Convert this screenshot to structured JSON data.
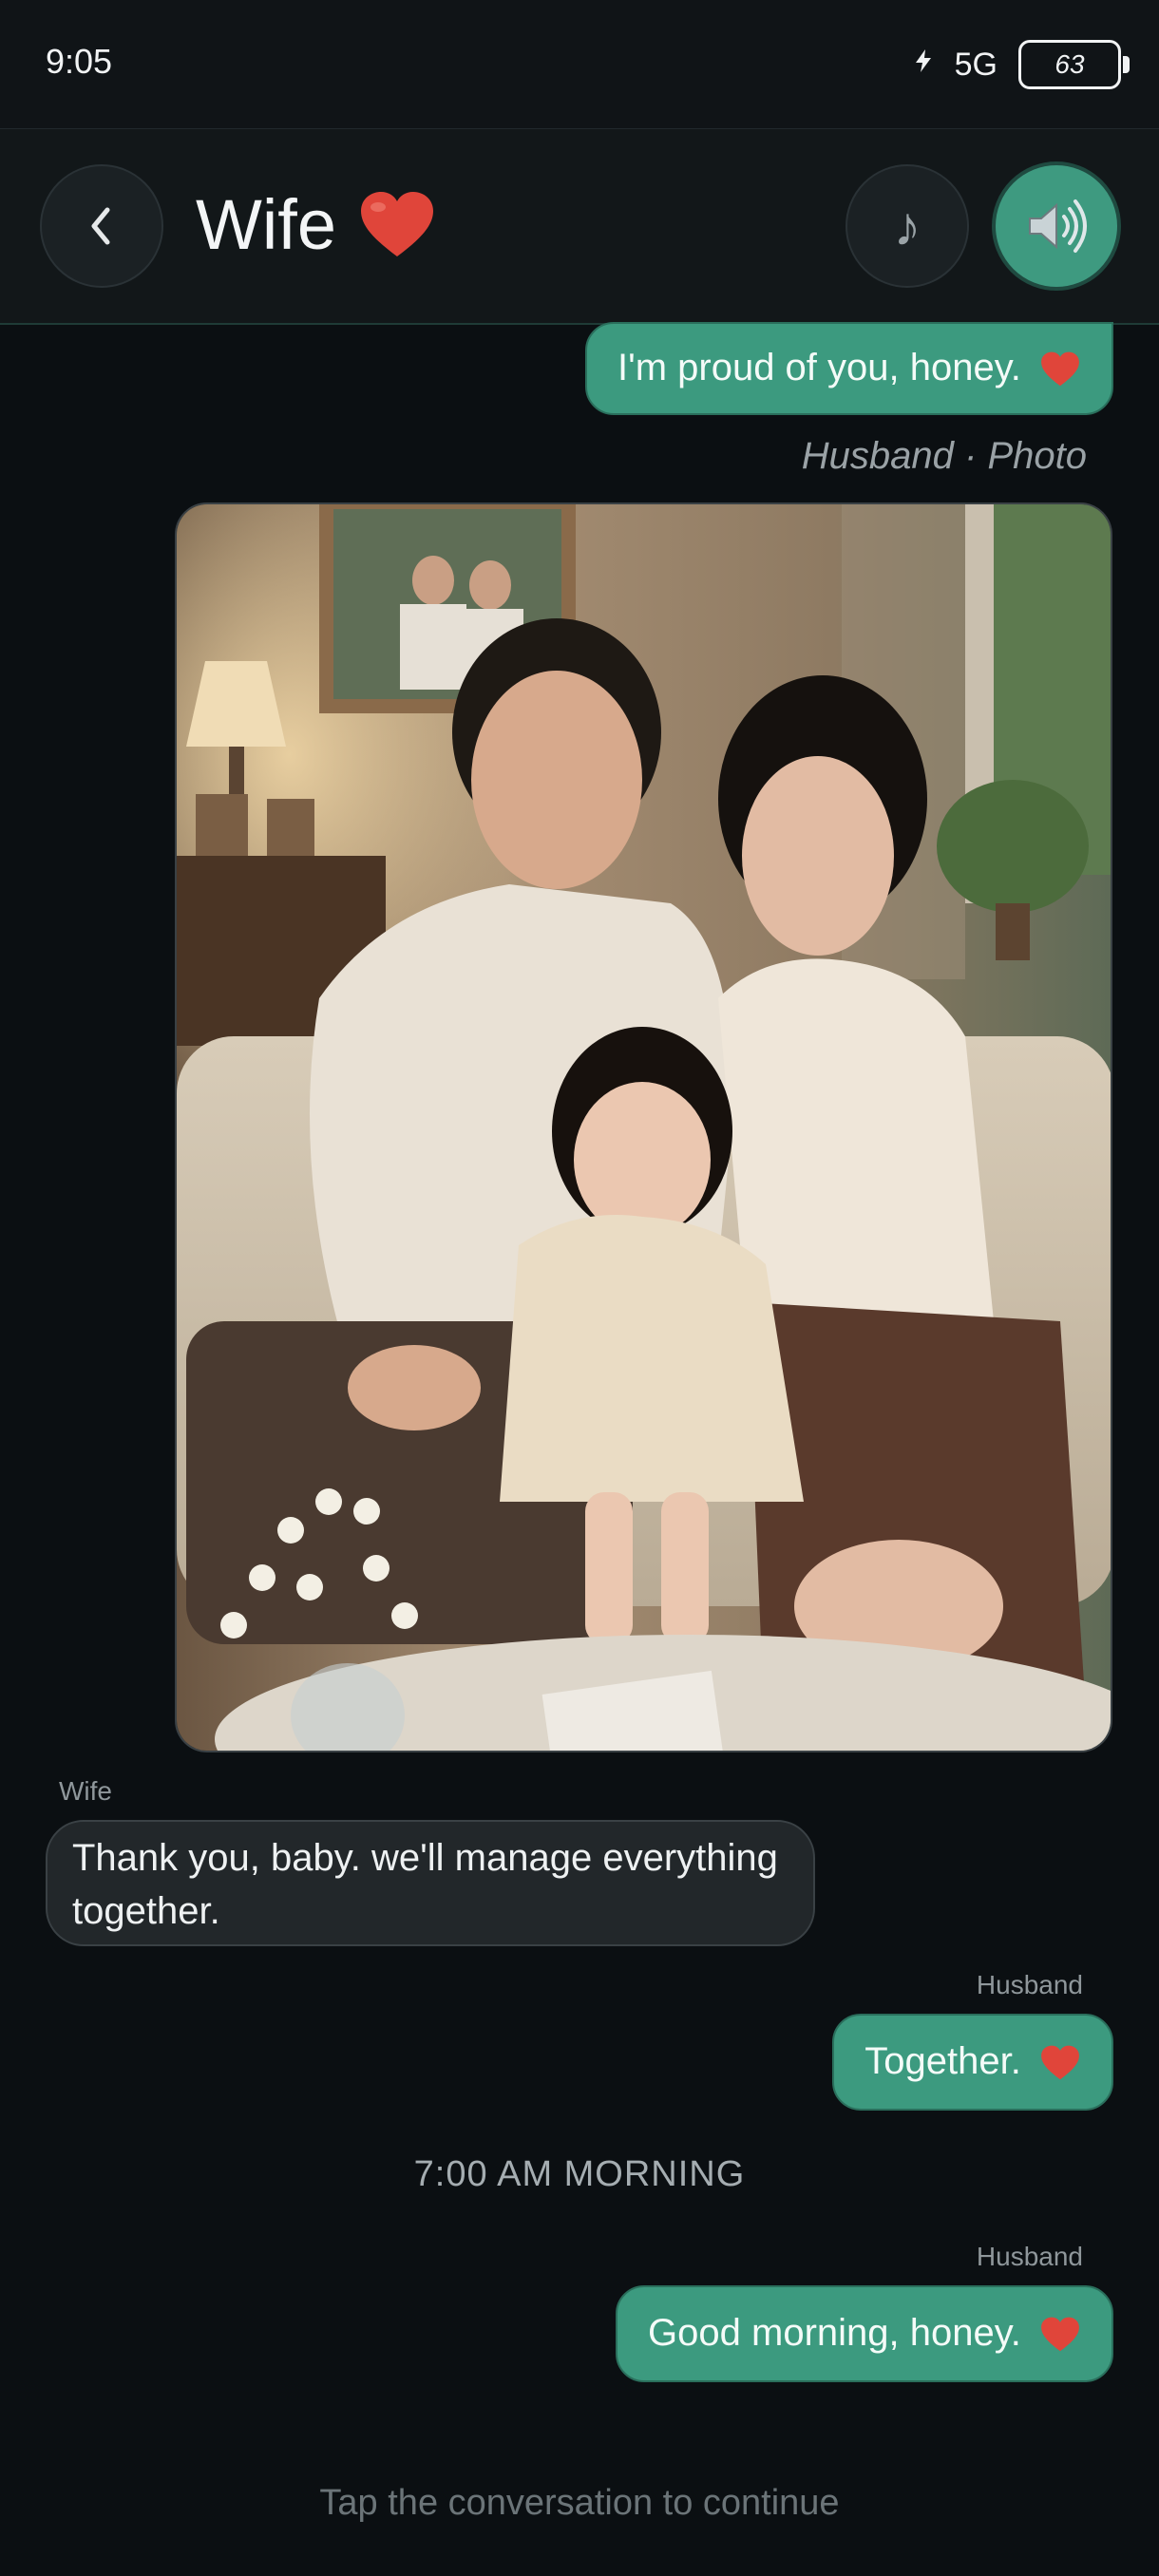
{
  "status_bar": {
    "time": "9:05",
    "network": "5G",
    "battery": "63"
  },
  "header": {
    "contact_name": "Wife",
    "back_icon": "chevron-left-icon",
    "music_icon": "music-note-icon",
    "speaker_icon": "speaker-sound-icon"
  },
  "messages": [
    {
      "from": "Husband",
      "text": "I'm proud of you, honey.",
      "emoji": "heart"
    },
    {
      "caption": "Husband · Photo"
    },
    {
      "from": "Wife",
      "sender_label": "Wife",
      "text": "Thank you, baby. we'll manage everything together."
    },
    {
      "from": "Husband",
      "sender_label": "Husband",
      "text": "Together.",
      "emoji": "heart"
    },
    {
      "time_divider": "7:00 AM MORNING"
    },
    {
      "from": "Husband",
      "sender_label": "Husband",
      "text": "Good morning, honey.",
      "emoji": "heart"
    }
  ],
  "footer": {
    "hint": "Tap the conversation to continue"
  },
  "colors": {
    "background": "#0b0f12",
    "outgoing_bubble": "#3c9a7f",
    "incoming_bubble": "#22272a",
    "accent": "#3e9a80"
  }
}
